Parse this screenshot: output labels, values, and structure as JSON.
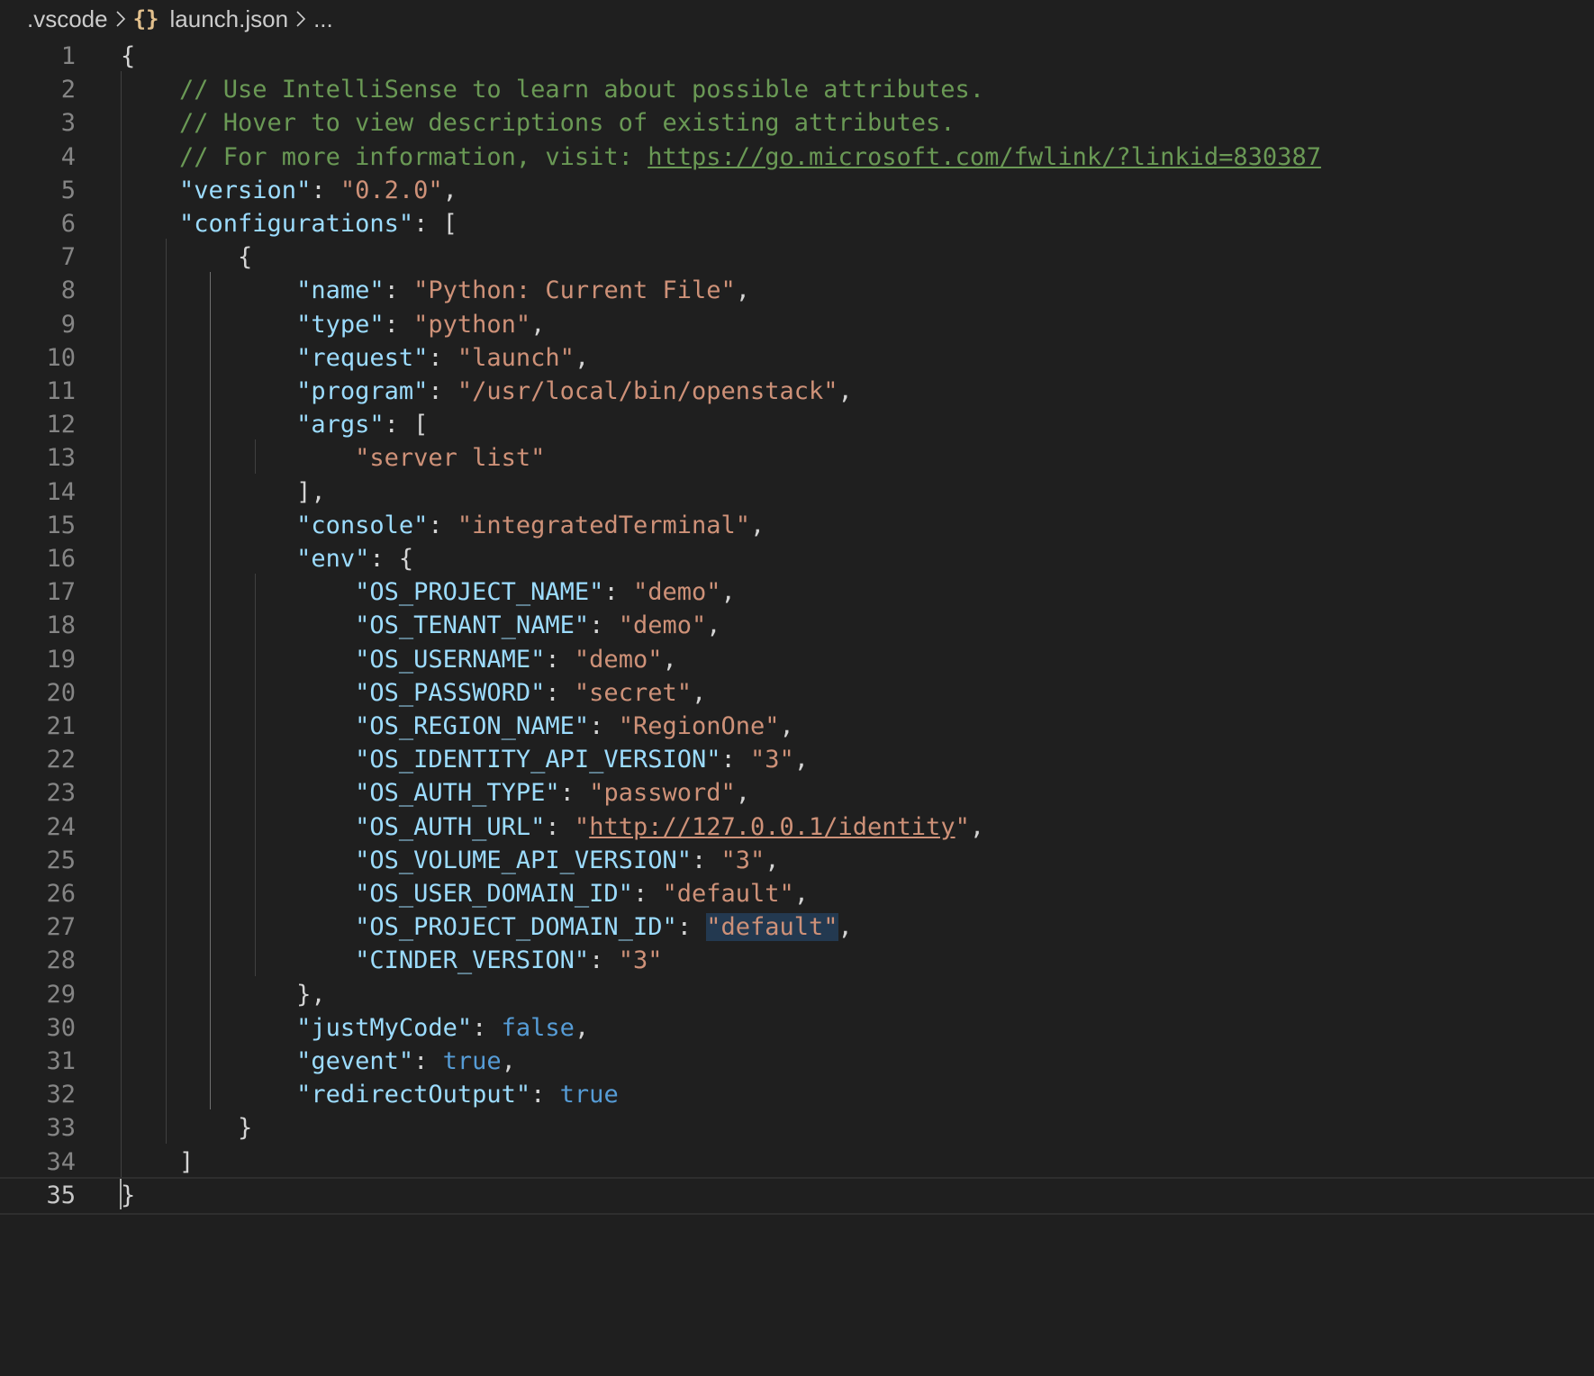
{
  "breadcrumb": {
    "folder": ".vscode",
    "file_icon": "{}",
    "file": "launch.json",
    "more": "..."
  },
  "editor": {
    "current_line": 35,
    "lines": [
      {
        "n": "1",
        "tokens": [
          [
            "p",
            "{"
          ]
        ]
      },
      {
        "n": "2",
        "tokens": [
          [
            "c",
            "    // Use IntelliSense to learn about possible attributes."
          ]
        ]
      },
      {
        "n": "3",
        "tokens": [
          [
            "c",
            "    // Hover to view descriptions of existing attributes."
          ]
        ]
      },
      {
        "n": "4",
        "tokens": [
          [
            "c",
            "    // For more information, visit: "
          ],
          [
            "c u",
            "https://go.microsoft.com/fwlink/?linkid=830387"
          ]
        ]
      },
      {
        "n": "5",
        "tokens": [
          [
            "k",
            "    \"version\""
          ],
          [
            "p",
            ": "
          ],
          [
            "s",
            "\"0.2.0\""
          ],
          [
            "p",
            ","
          ]
        ]
      },
      {
        "n": "6",
        "tokens": [
          [
            "k",
            "    \"configurations\""
          ],
          [
            "p",
            ": ["
          ]
        ]
      },
      {
        "n": "7",
        "tokens": [
          [
            "p",
            "        {"
          ]
        ]
      },
      {
        "n": "8",
        "tokens": [
          [
            "k",
            "            \"name\""
          ],
          [
            "p",
            ": "
          ],
          [
            "s",
            "\"Python: Current File\""
          ],
          [
            "p",
            ","
          ]
        ]
      },
      {
        "n": "9",
        "tokens": [
          [
            "k",
            "            \"type\""
          ],
          [
            "p",
            ": "
          ],
          [
            "s",
            "\"python\""
          ],
          [
            "p",
            ","
          ]
        ]
      },
      {
        "n": "10",
        "tokens": [
          [
            "k",
            "            \"request\""
          ],
          [
            "p",
            ": "
          ],
          [
            "s",
            "\"launch\""
          ],
          [
            "p",
            ","
          ]
        ]
      },
      {
        "n": "11",
        "tokens": [
          [
            "k",
            "            \"program\""
          ],
          [
            "p",
            ": "
          ],
          [
            "s",
            "\"/usr/local/bin/openstack\""
          ],
          [
            "p",
            ","
          ]
        ]
      },
      {
        "n": "12",
        "tokens": [
          [
            "k",
            "            \"args\""
          ],
          [
            "p",
            ": ["
          ]
        ]
      },
      {
        "n": "13",
        "tokens": [
          [
            "s",
            "                \"server list\""
          ]
        ]
      },
      {
        "n": "14",
        "tokens": [
          [
            "p",
            "            ],"
          ]
        ]
      },
      {
        "n": "15",
        "tokens": [
          [
            "k",
            "            \"console\""
          ],
          [
            "p",
            ": "
          ],
          [
            "s",
            "\"integratedTerminal\""
          ],
          [
            "p",
            ","
          ]
        ]
      },
      {
        "n": "16",
        "tokens": [
          [
            "k",
            "            \"env\""
          ],
          [
            "p",
            ": {"
          ]
        ]
      },
      {
        "n": "17",
        "tokens": [
          [
            "k",
            "                \"OS_PROJECT_NAME\""
          ],
          [
            "p",
            ": "
          ],
          [
            "s",
            "\"demo\""
          ],
          [
            "p",
            ","
          ]
        ]
      },
      {
        "n": "18",
        "tokens": [
          [
            "k",
            "                \"OS_TENANT_NAME\""
          ],
          [
            "p",
            ": "
          ],
          [
            "s",
            "\"demo\""
          ],
          [
            "p",
            ","
          ]
        ]
      },
      {
        "n": "19",
        "tokens": [
          [
            "k",
            "                \"OS_USERNAME\""
          ],
          [
            "p",
            ": "
          ],
          [
            "s",
            "\"demo\""
          ],
          [
            "p",
            ","
          ]
        ]
      },
      {
        "n": "20",
        "tokens": [
          [
            "k",
            "                \"OS_PASSWORD\""
          ],
          [
            "p",
            ": "
          ],
          [
            "s",
            "\"secret\""
          ],
          [
            "p",
            ","
          ]
        ]
      },
      {
        "n": "21",
        "tokens": [
          [
            "k",
            "                \"OS_REGION_NAME\""
          ],
          [
            "p",
            ": "
          ],
          [
            "s",
            "\"RegionOne\""
          ],
          [
            "p",
            ","
          ]
        ]
      },
      {
        "n": "22",
        "tokens": [
          [
            "k",
            "                \"OS_IDENTITY_API_VERSION\""
          ],
          [
            "p",
            ": "
          ],
          [
            "s",
            "\"3\""
          ],
          [
            "p",
            ","
          ]
        ]
      },
      {
        "n": "23",
        "tokens": [
          [
            "k",
            "                \"OS_AUTH_TYPE\""
          ],
          [
            "p",
            ": "
          ],
          [
            "s",
            "\"password\""
          ],
          [
            "p",
            ","
          ]
        ]
      },
      {
        "n": "24",
        "tokens": [
          [
            "k",
            "                \"OS_AUTH_URL\""
          ],
          [
            "p",
            ": "
          ],
          [
            "s",
            "\""
          ],
          [
            "s u",
            "http://127.0.0.1/identity"
          ],
          [
            "s",
            "\""
          ],
          [
            "p",
            ","
          ]
        ]
      },
      {
        "n": "25",
        "tokens": [
          [
            "k",
            "                \"OS_VOLUME_API_VERSION\""
          ],
          [
            "p",
            ": "
          ],
          [
            "s",
            "\"3\""
          ],
          [
            "p",
            ","
          ]
        ]
      },
      {
        "n": "26",
        "tokens": [
          [
            "k",
            "                \"OS_USER_DOMAIN_ID\""
          ],
          [
            "p",
            ": "
          ],
          [
            "s",
            "\"default\""
          ],
          [
            "p",
            ","
          ]
        ]
      },
      {
        "n": "27",
        "tokens": [
          [
            "k",
            "                \"OS_PROJECT_DOMAIN_ID\""
          ],
          [
            "p",
            ": "
          ],
          [
            "s hl",
            "\"default\""
          ],
          [
            "p",
            ","
          ]
        ]
      },
      {
        "n": "28",
        "tokens": [
          [
            "k",
            "                \"CINDER_VERSION\""
          ],
          [
            "p",
            ": "
          ],
          [
            "s",
            "\"3\""
          ]
        ]
      },
      {
        "n": "29",
        "tokens": [
          [
            "p",
            "            },"
          ]
        ]
      },
      {
        "n": "30",
        "tokens": [
          [
            "k",
            "            \"justMyCode\""
          ],
          [
            "p",
            ": "
          ],
          [
            "b",
            "false"
          ],
          [
            "p",
            ","
          ]
        ]
      },
      {
        "n": "31",
        "tokens": [
          [
            "k",
            "            \"gevent\""
          ],
          [
            "p",
            ": "
          ],
          [
            "b",
            "true"
          ],
          [
            "p",
            ","
          ]
        ]
      },
      {
        "n": "32",
        "tokens": [
          [
            "k",
            "            \"redirectOutput\""
          ],
          [
            "p",
            ": "
          ],
          [
            "b",
            "true"
          ]
        ]
      },
      {
        "n": "33",
        "tokens": [
          [
            "p",
            "        }"
          ]
        ]
      },
      {
        "n": "34",
        "tokens": [
          [
            "p",
            "    ]"
          ]
        ]
      },
      {
        "n": "35",
        "tokens": [
          [
            "p",
            "}"
          ]
        ]
      }
    ]
  }
}
